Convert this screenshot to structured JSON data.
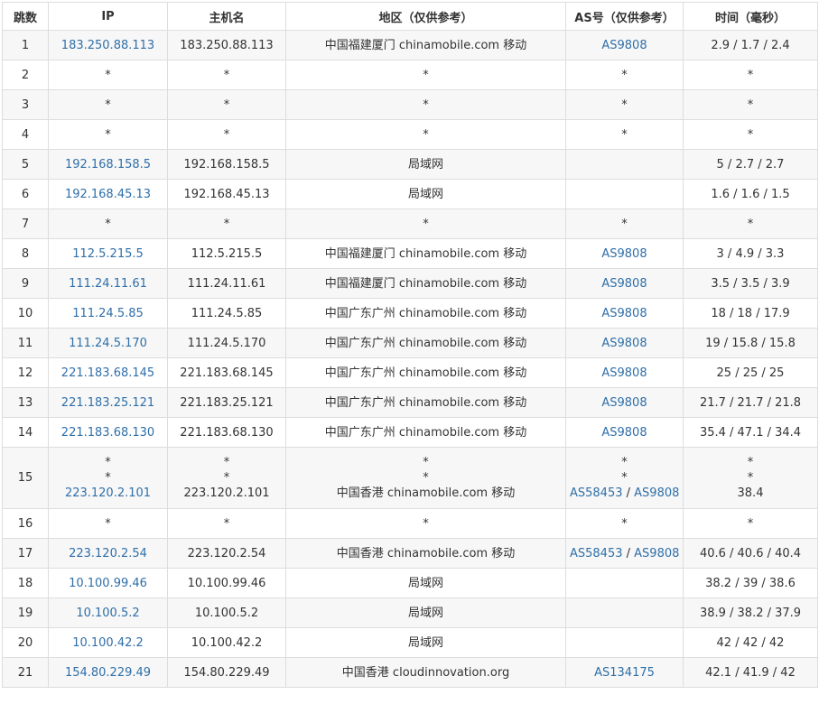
{
  "headers": [
    "跳数",
    "IP",
    "主机名",
    "地区（仅供参考）",
    "AS号（仅供参考）",
    "时间（毫秒）"
  ],
  "rows": [
    {
      "hop": "1",
      "ip": [
        "183.250.88.113"
      ],
      "host": [
        "183.250.88.113"
      ],
      "region": [
        "中国福建厦门 chinamobile.com 移动"
      ],
      "as": [
        [
          "AS9808"
        ]
      ],
      "time": [
        "2.9 / 1.7 / 2.4"
      ]
    },
    {
      "hop": "2",
      "ip": [
        "*"
      ],
      "host": [
        "*"
      ],
      "region": [
        "*"
      ],
      "as": [
        [
          "*"
        ]
      ],
      "time": [
        "*"
      ]
    },
    {
      "hop": "3",
      "ip": [
        "*"
      ],
      "host": [
        "*"
      ],
      "region": [
        "*"
      ],
      "as": [
        [
          "*"
        ]
      ],
      "time": [
        "*"
      ]
    },
    {
      "hop": "4",
      "ip": [
        "*"
      ],
      "host": [
        "*"
      ],
      "region": [
        "*"
      ],
      "as": [
        [
          "*"
        ]
      ],
      "time": [
        "*"
      ]
    },
    {
      "hop": "5",
      "ip": [
        "192.168.158.5"
      ],
      "host": [
        "192.168.158.5"
      ],
      "region": [
        "局域网"
      ],
      "as": [
        []
      ],
      "time": [
        "5 / 2.7 / 2.7"
      ]
    },
    {
      "hop": "6",
      "ip": [
        "192.168.45.13"
      ],
      "host": [
        "192.168.45.13"
      ],
      "region": [
        "局域网"
      ],
      "as": [
        []
      ],
      "time": [
        "1.6 / 1.6 / 1.5"
      ]
    },
    {
      "hop": "7",
      "ip": [
        "*"
      ],
      "host": [
        "*"
      ],
      "region": [
        "*"
      ],
      "as": [
        [
          "*"
        ]
      ],
      "time": [
        "*"
      ]
    },
    {
      "hop": "8",
      "ip": [
        "112.5.215.5"
      ],
      "host": [
        "112.5.215.5"
      ],
      "region": [
        "中国福建厦门 chinamobile.com 移动"
      ],
      "as": [
        [
          "AS9808"
        ]
      ],
      "time": [
        "3 / 4.9 / 3.3"
      ]
    },
    {
      "hop": "9",
      "ip": [
        "111.24.11.61"
      ],
      "host": [
        "111.24.11.61"
      ],
      "region": [
        "中国福建厦门 chinamobile.com 移动"
      ],
      "as": [
        [
          "AS9808"
        ]
      ],
      "time": [
        "3.5 / 3.5 / 3.9"
      ]
    },
    {
      "hop": "10",
      "ip": [
        "111.24.5.85"
      ],
      "host": [
        "111.24.5.85"
      ],
      "region": [
        "中国广东广州 chinamobile.com 移动"
      ],
      "as": [
        [
          "AS9808"
        ]
      ],
      "time": [
        "18 / 18 / 17.9"
      ]
    },
    {
      "hop": "11",
      "ip": [
        "111.24.5.170"
      ],
      "host": [
        "111.24.5.170"
      ],
      "region": [
        "中国广东广州 chinamobile.com 移动"
      ],
      "as": [
        [
          "AS9808"
        ]
      ],
      "time": [
        "19 / 15.8 / 15.8"
      ]
    },
    {
      "hop": "12",
      "ip": [
        "221.183.68.145"
      ],
      "host": [
        "221.183.68.145"
      ],
      "region": [
        "中国广东广州 chinamobile.com 移动"
      ],
      "as": [
        [
          "AS9808"
        ]
      ],
      "time": [
        "25 / 25 / 25"
      ]
    },
    {
      "hop": "13",
      "ip": [
        "221.183.25.121"
      ],
      "host": [
        "221.183.25.121"
      ],
      "region": [
        "中国广东广州 chinamobile.com 移动"
      ],
      "as": [
        [
          "AS9808"
        ]
      ],
      "time": [
        "21.7 / 21.7 / 21.8"
      ]
    },
    {
      "hop": "14",
      "ip": [
        "221.183.68.130"
      ],
      "host": [
        "221.183.68.130"
      ],
      "region": [
        "中国广东广州 chinamobile.com 移动"
      ],
      "as": [
        [
          "AS9808"
        ]
      ],
      "time": [
        "35.4 / 47.1 / 34.4"
      ]
    },
    {
      "hop": "15",
      "ip": [
        "*",
        "*",
        "223.120.2.101"
      ],
      "host": [
        "*",
        "*",
        "223.120.2.101"
      ],
      "region": [
        "*",
        "*",
        "中国香港 chinamobile.com 移动"
      ],
      "as": [
        [
          "*"
        ],
        [
          "*"
        ],
        [
          "AS58453",
          "AS9808"
        ]
      ],
      "time": [
        "*",
        "*",
        "38.4"
      ]
    },
    {
      "hop": "16",
      "ip": [
        "*"
      ],
      "host": [
        "*"
      ],
      "region": [
        "*"
      ],
      "as": [
        [
          "*"
        ]
      ],
      "time": [
        "*"
      ]
    },
    {
      "hop": "17",
      "ip": [
        "223.120.2.54"
      ],
      "host": [
        "223.120.2.54"
      ],
      "region": [
        "中国香港 chinamobile.com 移动"
      ],
      "as": [
        [
          "AS58453",
          "AS9808"
        ]
      ],
      "time": [
        "40.6 / 40.6 / 40.4"
      ]
    },
    {
      "hop": "18",
      "ip": [
        "10.100.99.46"
      ],
      "host": [
        "10.100.99.46"
      ],
      "region": [
        "局域网"
      ],
      "as": [
        []
      ],
      "time": [
        "38.2 / 39 / 38.6"
      ]
    },
    {
      "hop": "19",
      "ip": [
        "10.100.5.2"
      ],
      "host": [
        "10.100.5.2"
      ],
      "region": [
        "局域网"
      ],
      "as": [
        []
      ],
      "time": [
        "38.9 / 38.2 / 37.9"
      ]
    },
    {
      "hop": "20",
      "ip": [
        "10.100.42.2"
      ],
      "host": [
        "10.100.42.2"
      ],
      "region": [
        "局域网"
      ],
      "as": [
        []
      ],
      "time": [
        "42 / 42 / 42"
      ]
    },
    {
      "hop": "21",
      "ip": [
        "154.80.229.49"
      ],
      "host": [
        "154.80.229.49"
      ],
      "region": [
        "中国香港 cloudinnovation.org"
      ],
      "as": [
        [
          "AS134175"
        ]
      ],
      "time": [
        "42.1 / 41.9 / 42"
      ]
    }
  ]
}
